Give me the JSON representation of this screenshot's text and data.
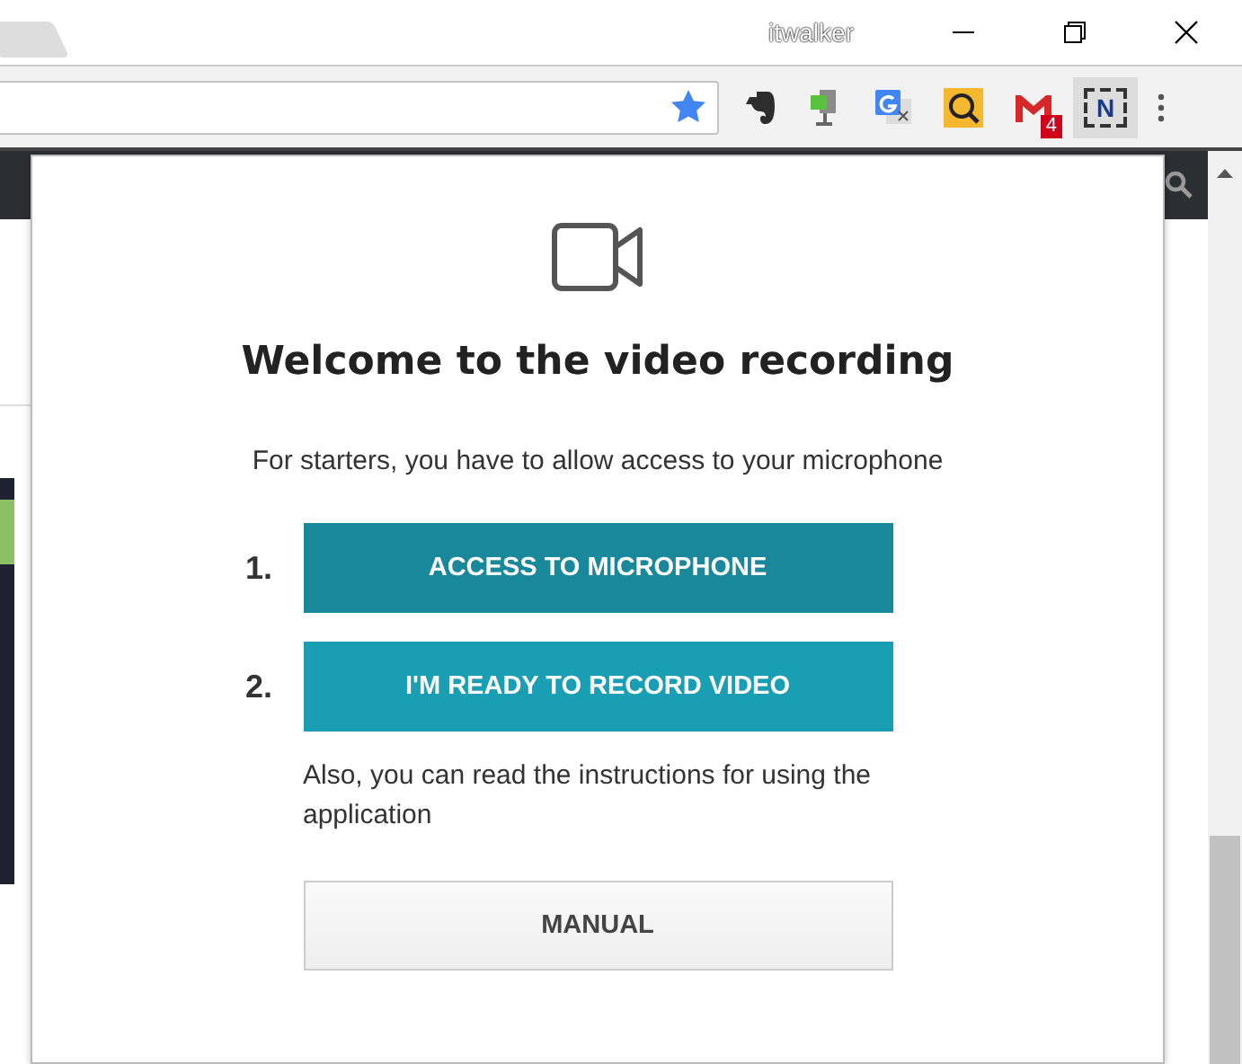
{
  "window": {
    "user": "itwalker"
  },
  "toolbar": {
    "gmail_badge": "4",
    "extension_letter": "N",
    "extension_selected": true
  },
  "popup": {
    "title": "Welcome to the video recording",
    "intro": "For starters, you have to allow access to your microphone",
    "steps": [
      {
        "number": "1.",
        "label": "ACCESS TO MICROPHONE"
      },
      {
        "number": "2.",
        "label": "I'M READY TO RECORD VIDEO"
      }
    ],
    "note": "Also, you can read the instructions for using the application",
    "manual_button": "MANUAL"
  }
}
